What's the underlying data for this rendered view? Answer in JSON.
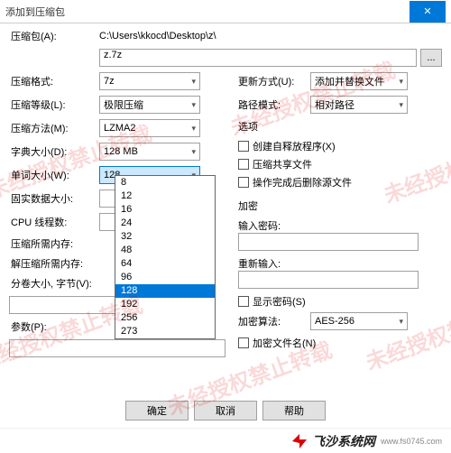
{
  "title": "添加到压缩包",
  "watermark": "未经授权禁止转载",
  "archive": {
    "label": "压缩包(A):",
    "path": "C:\\Users\\kkocd\\Desktop\\z\\",
    "file": "z.7z"
  },
  "browse_btn": "...",
  "left": {
    "format": {
      "label": "压缩格式:",
      "value": "7z"
    },
    "level": {
      "label": "压缩等级(L):",
      "value": "极限压缩"
    },
    "method": {
      "label": "压缩方法(M):",
      "value": "LZMA2"
    },
    "dict": {
      "label": "字典大小(D):",
      "value": "128 MB"
    },
    "word": {
      "label": "单词大小(W):",
      "value": "128"
    },
    "solid": {
      "label": "固实数据大小:"
    },
    "cpu": {
      "label": "CPU 线程数:"
    },
    "mem_c": {
      "label": "压缩所需内存:"
    },
    "mem_d": {
      "label": "解压缩所需内存:"
    },
    "split": {
      "label": "分卷大小, 字节(V):"
    },
    "params": {
      "label": "参数(P):"
    }
  },
  "right": {
    "update": {
      "label": "更新方式(U):",
      "value": "添加并替换文件"
    },
    "pathmode": {
      "label": "路径模式:",
      "value": "相对路径"
    },
    "options_title": "选项",
    "opts": {
      "sfx": "创建自释放程序(X)",
      "share": "压缩共享文件",
      "delete": "操作完成后删除源文件"
    },
    "encrypt_title": "加密",
    "pw1": "输入密码:",
    "pw2": "重新输入:",
    "showpw": "显示密码(S)",
    "algo": {
      "label": "加密算法:",
      "value": "AES-256"
    },
    "encnames": "加密文件名(N)"
  },
  "dropdown_options": [
    "8",
    "12",
    "16",
    "24",
    "32",
    "48",
    "64",
    "96",
    "128",
    "192",
    "256",
    "273"
  ],
  "dropdown_selected": "128",
  "buttons": {
    "ok": "确定",
    "cancel": "取消",
    "help": "帮助"
  },
  "brand": {
    "name": "飞沙系统网",
    "url": "www.fs0745.com"
  }
}
